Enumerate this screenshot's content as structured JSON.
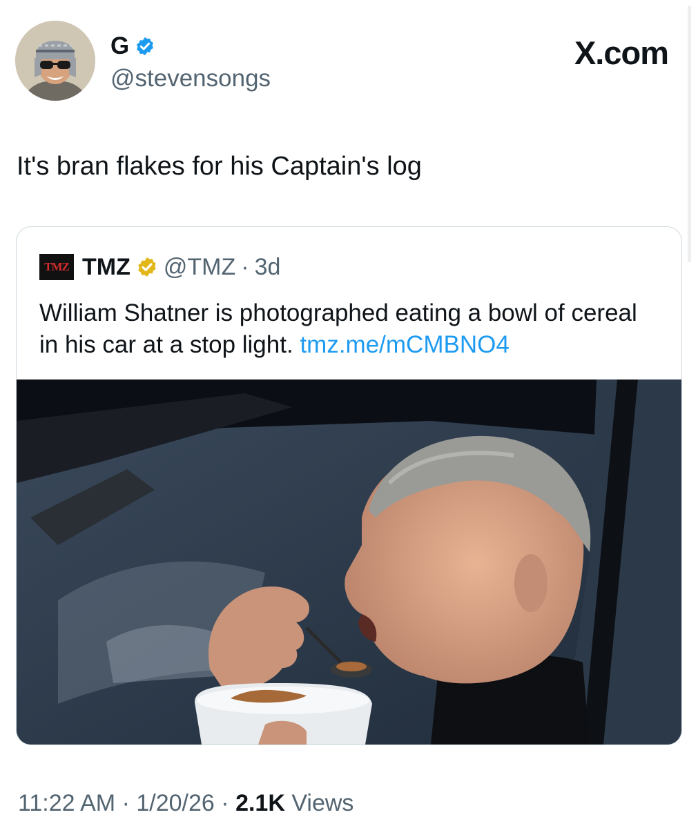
{
  "author": {
    "display_name": "G",
    "handle": "@stevensongs",
    "avatar_icon": "user-avatar",
    "verified_icon": "blue-verified-badge-icon"
  },
  "brand": {
    "label": "X.com"
  },
  "tweet": {
    "text": "It's bran flakes for his Captain's log"
  },
  "quoted_tweet": {
    "logo_label": "TMZ",
    "author_name": "TMZ",
    "verified_icon": "gold-verified-badge-icon",
    "handle": "@TMZ",
    "separator": "·",
    "time": "3d",
    "text": "William Shatner is photographed eating a bowl of cereal in his car at a stop light.",
    "link": "tmz.me/mCMBNO4",
    "media": "photo-man-eating-cereal-in-car"
  },
  "meta": {
    "time": "11:22 AM",
    "sep1": "·",
    "date": "1/20/26",
    "sep2": "·",
    "views_count": "2.1K",
    "views_label": "Views"
  },
  "colors": {
    "text_primary": "#0f1419",
    "text_secondary": "#536471",
    "link": "#1d9bf0",
    "border": "#cfd9de",
    "blue_badge": "#1d9bf0",
    "gold_badge": "#e2b719"
  }
}
